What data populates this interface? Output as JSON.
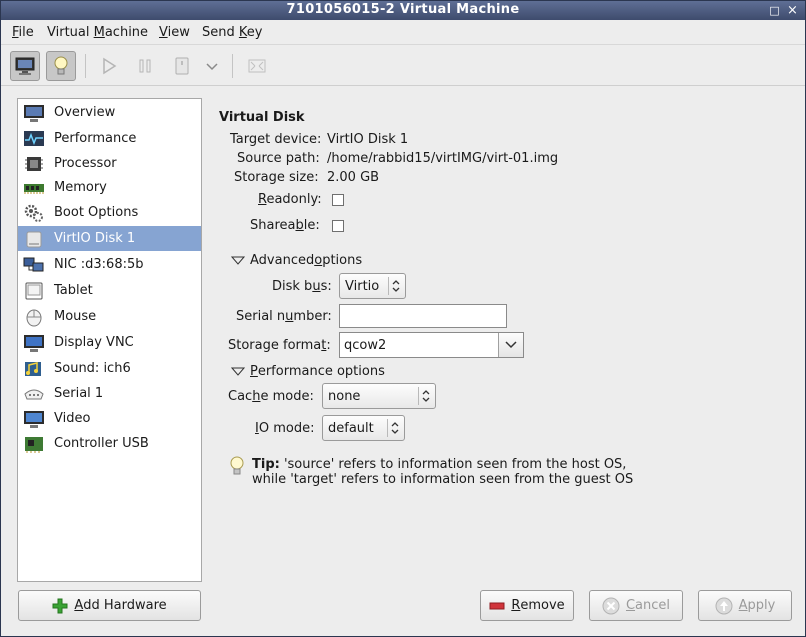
{
  "window": {
    "title": "7101056015-2 Virtual Machine",
    "controls": [
      "□",
      "×"
    ]
  },
  "menubar": [
    {
      "label": "File",
      "mnemonic": "F",
      "rest": "ile"
    },
    {
      "label": "Virtual Machine",
      "mnemonic": "",
      "pre": "Virtual ",
      "mn2": "M",
      "rest": "achine"
    },
    {
      "label": "View",
      "mnemonic": "V",
      "rest": "iew"
    },
    {
      "label": "Send Key",
      "pre": "Send ",
      "mn2": "K",
      "rest": "ey"
    }
  ],
  "toolbar": {
    "icons": [
      "console-icon",
      "details-lightbulb-icon",
      "run-icon",
      "pause-icon",
      "shutdown-icon",
      "shutdown-menu-icon",
      "fullscreen-icon"
    ]
  },
  "sidebar": {
    "selected_index": 5,
    "items": [
      {
        "label": "Overview",
        "icon": "overview-icon"
      },
      {
        "label": "Performance",
        "icon": "performance-icon"
      },
      {
        "label": "Processor",
        "icon": "processor-icon"
      },
      {
        "label": "Memory",
        "icon": "memory-icon"
      },
      {
        "label": "Boot Options",
        "icon": "boot-options-icon"
      },
      {
        "label": "VirtIO Disk 1",
        "icon": "disk-icon"
      },
      {
        "label": "NIC :d3:68:5b",
        "icon": "nic-icon"
      },
      {
        "label": "Tablet",
        "icon": "tablet-icon"
      },
      {
        "label": "Mouse",
        "icon": "mouse-icon"
      },
      {
        "label": "Display VNC",
        "icon": "display-icon"
      },
      {
        "label": "Sound: ich6",
        "icon": "sound-icon"
      },
      {
        "label": "Serial 1",
        "icon": "serial-icon"
      },
      {
        "label": "Video",
        "icon": "video-icon"
      },
      {
        "label": "Controller USB",
        "icon": "controller-icon"
      }
    ]
  },
  "buttons": {
    "add_hardware": {
      "pre": "",
      "mn": "A",
      "rest": "dd Hardware"
    },
    "remove": {
      "pre": "",
      "mn": "R",
      "rest": "emove"
    },
    "cancel": {
      "pre": "",
      "mn": "C",
      "rest": "ancel"
    },
    "apply": {
      "pre": "",
      "mn": "A",
      "rest": "pply"
    }
  },
  "disk": {
    "heading": "Virtual Disk",
    "target_device_label": "Target device:",
    "target_device": "VirtIO Disk 1",
    "source_path_label": "Source path:",
    "source_path": "/home/rabbid15/virtIMG/virt-01.img",
    "storage_size_label": "Storage size:",
    "storage_size": "2.00 GB",
    "readonly": {
      "pre": "",
      "mn": "R",
      "rest": "eadonly:"
    },
    "shareable": {
      "pre": "Sharea",
      "mn": "b",
      "rest": "le:"
    }
  },
  "advanced": {
    "pre": "Advanced ",
    "mn": "o",
    "rest": "ptions",
    "disk_bus": {
      "pre": "Disk b",
      "mn": "u",
      "rest": "s:"
    },
    "disk_bus_value": "Virtio",
    "serial_number": {
      "pre": "Serial n",
      "mn": "u",
      "rest": "mber:"
    },
    "serial_number_value": "",
    "storage_format": {
      "pre": "Storage forma",
      "mn": "t",
      "rest": ":"
    },
    "storage_format_value": "qcow2"
  },
  "performance": {
    "pre": "",
    "mn": "P",
    "rest": "erformance options",
    "cache_mode": {
      "pre": "Cac",
      "mn": "h",
      "rest": "e mode:"
    },
    "cache_mode_value": "none",
    "io_mode": {
      "pre": "",
      "mn": "I",
      "rest": "O mode:"
    },
    "io_mode_value": "default"
  },
  "tip": {
    "bold": "Tip:",
    "line1": " 'source' refers to information seen from the host OS,",
    "line2": "while 'target' refers to information seen from the guest OS"
  },
  "colors": {
    "selection": "#86a4d2",
    "titlebar": "#4a5a7e",
    "add_icon": "#3aa335",
    "remove_icon": "#d0343b"
  }
}
